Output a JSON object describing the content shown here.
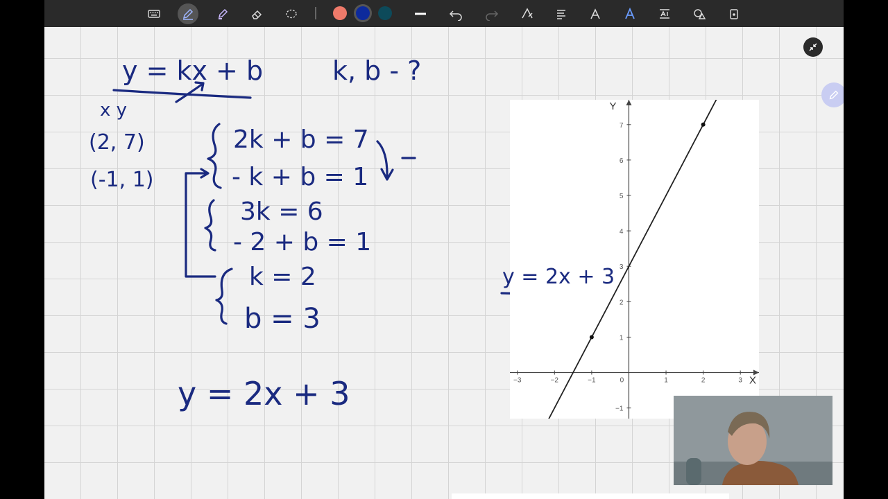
{
  "toolbar": {
    "tools": [
      {
        "name": "keyboard-icon"
      },
      {
        "name": "pen-icon",
        "active": true
      },
      {
        "name": "highlighter-icon"
      },
      {
        "name": "eraser-icon"
      },
      {
        "name": "lasso-icon"
      }
    ],
    "colors": [
      {
        "name": "color-swatch-red",
        "hex": "#ee7a6a"
      },
      {
        "name": "color-swatch-blue",
        "hex": "#0d2a9c",
        "selected": true
      },
      {
        "name": "color-swatch-teal",
        "hex": "#0d4a5a"
      }
    ],
    "actions": [
      {
        "name": "stroke-width-icon"
      },
      {
        "name": "undo-icon"
      },
      {
        "name": "redo-icon"
      },
      {
        "name": "shape-pen-icon"
      },
      {
        "name": "text-lines-icon"
      },
      {
        "name": "text-style-icon"
      },
      {
        "name": "ai-text-icon"
      },
      {
        "name": "text-format-icon"
      },
      {
        "name": "shapes-icon"
      },
      {
        "name": "lock-icon"
      }
    ]
  },
  "handwriting": {
    "formula": "y = kx + b",
    "unknowns": "k, b - ?",
    "header_xy": "x  y",
    "point1": "(2, 7)",
    "point2": "(-1, 1)",
    "eq1": "2k + b = 7",
    "eq2": "- k + b = 1",
    "eq3": "3k = 6",
    "eq4": "- 2 + b = 1",
    "eq5": "k = 2",
    "eq6": "b = 3",
    "result": "y = 2x + 3",
    "graph_label": "y = 2x + 3"
  },
  "chart_data": {
    "type": "line",
    "xlabel": "X",
    "ylabel": "Y",
    "xlim": [
      -3.2,
      3.5
    ],
    "ylim": [
      -1.3,
      7.7
    ],
    "x_ticks": [
      -3,
      -2,
      -1,
      0,
      1,
      2,
      3
    ],
    "y_ticks": [
      -1,
      1,
      2,
      3,
      4,
      5,
      6,
      7
    ],
    "series": [
      {
        "equation": "y = 2x + 3",
        "x": [
          -3,
          3
        ],
        "y": [
          -3,
          9
        ]
      }
    ],
    "points": [
      {
        "x": -1,
        "y": 1
      },
      {
        "x": 2,
        "y": 7
      }
    ],
    "grid": false
  },
  "colors": {
    "ink": "#1a2a80",
    "app_bg": "#f1f1f1",
    "toolbar_bg": "#2a2a2a",
    "float_button": "#c9cdf2"
  }
}
